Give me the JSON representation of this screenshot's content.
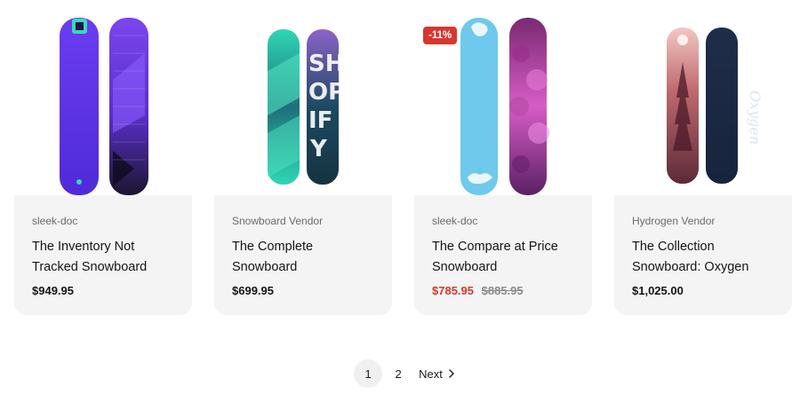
{
  "products": [
    {
      "vendor": "sleek-doc",
      "title_line1": "The Inventory Not",
      "title_line2": "Tracked Snowboard",
      "price": "$949.95",
      "on_sale": false,
      "badge": "",
      "compare_price": ""
    },
    {
      "vendor": "Snowboard Vendor",
      "title_line1": "The Complete",
      "title_line2": "Snowboard",
      "price": "$699.95",
      "on_sale": false,
      "badge": "",
      "compare_price": ""
    },
    {
      "vendor": "sleek-doc",
      "title_line1": "The Compare at Price",
      "title_line2": "Snowboard",
      "price": "$785.95",
      "on_sale": true,
      "badge": "-11%",
      "compare_price": "$885.95"
    },
    {
      "vendor": "Hydrogen Vendor",
      "title_line1": "The Collection",
      "title_line2": "Snowboard: Oxygen",
      "price": "$1,025.00",
      "on_sale": false,
      "badge": "",
      "compare_price": ""
    }
  ],
  "pagination": {
    "pages": [
      "1",
      "2"
    ],
    "current": "1",
    "next_label": "Next"
  },
  "colors": {
    "sale": "#d6372f",
    "card_bg": "#f4f4f4"
  }
}
